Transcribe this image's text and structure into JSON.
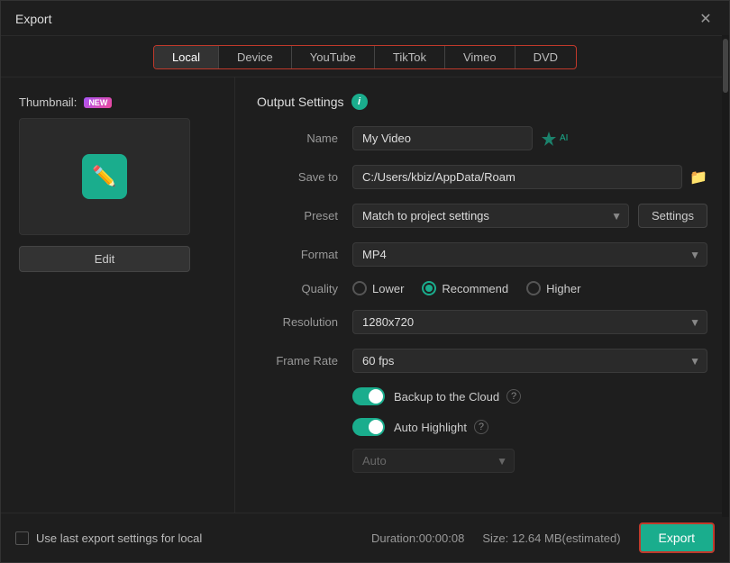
{
  "dialog": {
    "title": "Export"
  },
  "tabs": {
    "items": [
      {
        "id": "local",
        "label": "Local",
        "active": true
      },
      {
        "id": "device",
        "label": "Device",
        "active": false
      },
      {
        "id": "youtube",
        "label": "YouTube",
        "active": false
      },
      {
        "id": "tiktok",
        "label": "TikTok",
        "active": false
      },
      {
        "id": "vimeo",
        "label": "Vimeo",
        "active": false
      },
      {
        "id": "dvd",
        "label": "DVD",
        "active": false
      }
    ]
  },
  "left": {
    "thumbnail_label": "Thumbnail:",
    "edit_label": "Edit"
  },
  "output_settings": {
    "section_title": "Output Settings",
    "name_label": "Name",
    "name_value": "My Video",
    "save_to_label": "Save to",
    "save_to_value": "C:/Users/kbiz/AppData/Roam",
    "preset_label": "Preset",
    "preset_value": "Match to project settings",
    "settings_label": "Settings",
    "format_label": "Format",
    "format_value": "MP4",
    "quality_label": "Quality",
    "quality_options": [
      {
        "id": "lower",
        "label": "Lower",
        "checked": false
      },
      {
        "id": "recommend",
        "label": "Recommend",
        "checked": true
      },
      {
        "id": "higher",
        "label": "Higher",
        "checked": false
      }
    ],
    "resolution_label": "Resolution",
    "resolution_value": "1280x720",
    "frame_rate_label": "Frame Rate",
    "frame_rate_value": "60 fps",
    "backup_label": "Backup to the Cloud",
    "backup_on": true,
    "auto_highlight_label": "Auto Highlight",
    "auto_highlight_on": true,
    "auto_label": "Auto"
  },
  "bottom": {
    "use_last_label": "Use last export settings for local",
    "duration_label": "Duration:",
    "duration_value": "00:00:08",
    "size_label": "Size:",
    "size_value": "12.64 MB(estimated)",
    "export_label": "Export"
  }
}
